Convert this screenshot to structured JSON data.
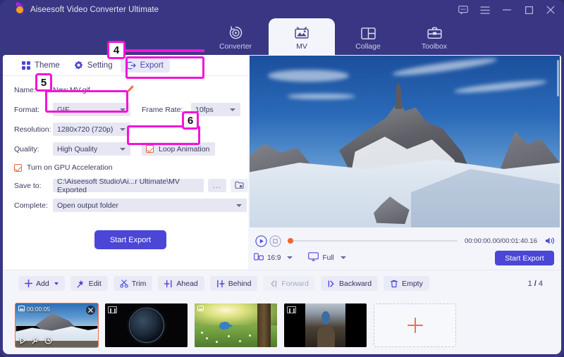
{
  "window": {
    "app_title": "Aiseesoft Video Converter Ultimate",
    "controls": [
      {
        "name": "feedback-icon",
        "label": "Feedback"
      },
      {
        "name": "menu-icon",
        "label": "Menu"
      },
      {
        "name": "minimize-icon",
        "label": "Minimize"
      },
      {
        "name": "maximize-icon",
        "label": "Maximize"
      },
      {
        "name": "close-icon",
        "label": "Close"
      }
    ]
  },
  "nav": {
    "tabs": [
      {
        "label": "Converter",
        "icon": "converter-icon",
        "active": false
      },
      {
        "label": "MV",
        "icon": "mv-icon",
        "active": true
      },
      {
        "label": "Collage",
        "icon": "collage-icon",
        "active": false
      },
      {
        "label": "Toolbox",
        "icon": "toolbox-icon",
        "active": false
      }
    ]
  },
  "subtabs": [
    {
      "label": "Theme",
      "icon": "grid-icon",
      "selected": false
    },
    {
      "label": "Setting",
      "icon": "gear-icon",
      "selected": false
    },
    {
      "label": "Export",
      "icon": "export-icon",
      "selected": true
    }
  ],
  "export_form": {
    "name_label": "Name:",
    "name_value": "New MV.gif",
    "format_label": "Format:",
    "format_value": "GIF",
    "frame_rate_label": "Frame Rate:",
    "frame_rate_value": "10fps",
    "resolution_label": "Resolution:",
    "resolution_value": "1280x720 (720p)",
    "quality_label": "Quality:",
    "quality_value": "High Quality",
    "loop_animation_label": "Loop Animation",
    "loop_animation_checked": true,
    "gpu_label": "Turn on GPU Acceleration",
    "gpu_checked": true,
    "save_to_label": "Save to:",
    "save_to_value": "C:\\Aiseesoft Studio\\Ai...r Ultimate\\MV Exported",
    "browse_dots": "...",
    "complete_label": "Complete:",
    "complete_value": "Open output folder",
    "start_export_label": "Start Export"
  },
  "preview": {
    "time_display": "00:00:00.00/00:01:40.16",
    "aspect_ratio": "16:9",
    "screen_mode": "Full",
    "start_export_label": "Start Export",
    "play_icon": "play-icon",
    "stop_icon": "stop-icon",
    "volume_icon": "volume-icon",
    "ratio_icon": "aspect-ratio-icon",
    "screen_icon": "monitor-icon"
  },
  "toolbar": {
    "buttons": [
      {
        "label": "Add",
        "icon": "plus-icon",
        "dropdown": true,
        "disabled": false
      },
      {
        "label": "Edit",
        "icon": "magic-wand-icon",
        "dropdown": false,
        "disabled": false
      },
      {
        "label": "Trim",
        "icon": "scissors-icon",
        "dropdown": false,
        "disabled": false
      },
      {
        "label": "Ahead",
        "icon": "insert-ahead-icon",
        "dropdown": false,
        "disabled": false
      },
      {
        "label": "Behind",
        "icon": "insert-behind-icon",
        "dropdown": false,
        "disabled": false
      },
      {
        "label": "Forward",
        "icon": "move-forward-icon",
        "dropdown": false,
        "disabled": true
      },
      {
        "label": "Backward",
        "icon": "move-backward-icon",
        "dropdown": false,
        "disabled": false
      },
      {
        "label": "Empty",
        "icon": "trash-icon",
        "dropdown": false,
        "disabled": false
      }
    ],
    "page_current": "1",
    "page_separator": "/",
    "page_total": "4"
  },
  "thumbnails": [
    {
      "duration": "00:00:05",
      "selected": true,
      "has_close": true,
      "icons": [
        "play-icon",
        "magic-wand-icon",
        "clock-icon"
      ],
      "badge_icon": "image-icon"
    },
    {
      "duration": "",
      "selected": false,
      "has_close": false,
      "icons": [],
      "badge_icon": "film-icon"
    },
    {
      "duration": "",
      "selected": false,
      "has_close": false,
      "icons": [],
      "badge_icon": "image-icon"
    },
    {
      "duration": "",
      "selected": false,
      "has_close": false,
      "icons": [],
      "badge_icon": "film-icon"
    }
  ],
  "add_thumbnail": {
    "icon": "plus-icon"
  },
  "annotations": [
    {
      "number": "4",
      "target": "export-subtab"
    },
    {
      "number": "5",
      "target": "format-dropdown"
    },
    {
      "number": "6",
      "target": "loop-animation-checkbox"
    }
  ],
  "colors": {
    "header_purple": "#393783",
    "accent_blue": "#4b46d6",
    "annotation_magenta": "#f215d6",
    "checkbox_orange": "#e8663c",
    "panel_bg": "#f4f5fb"
  }
}
